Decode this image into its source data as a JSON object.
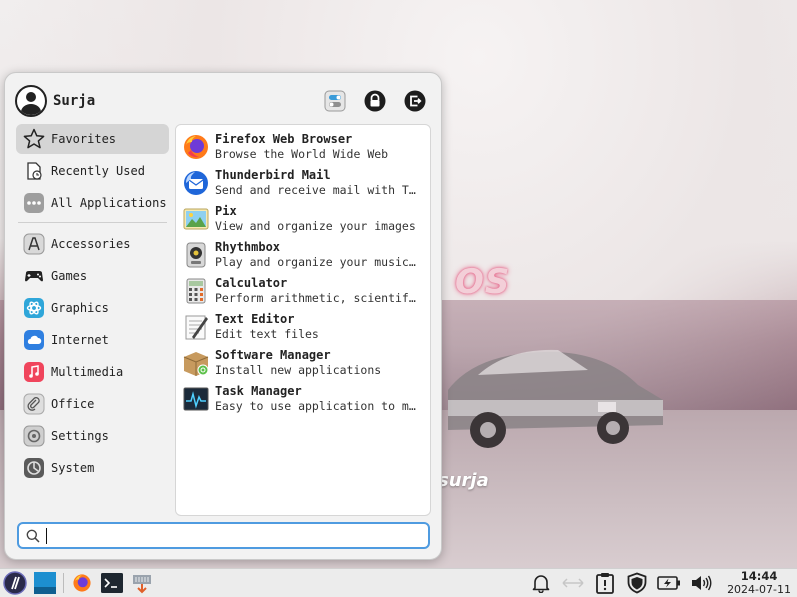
{
  "wallpaper": {
    "title": "OS",
    "subtitle": "surja"
  },
  "menu": {
    "username": "Surja",
    "categories": [
      {
        "label": "Favorites",
        "icon": "star-icon",
        "active": true
      },
      {
        "label": "Recently Used",
        "icon": "recent-document-icon"
      },
      {
        "label": "All Applications",
        "icon": "all-apps-icon"
      },
      {
        "label": "Accessories",
        "icon": "accessories-icon"
      },
      {
        "label": "Games",
        "icon": "gamepad-icon"
      },
      {
        "label": "Graphics",
        "icon": "graphics-icon"
      },
      {
        "label": "Internet",
        "icon": "cloud-icon"
      },
      {
        "label": "Multimedia",
        "icon": "music-note-icon"
      },
      {
        "label": "Office",
        "icon": "paperclip-icon"
      },
      {
        "label": "Settings",
        "icon": "settings-icon"
      },
      {
        "label": "System",
        "icon": "system-icon"
      }
    ],
    "apps": [
      {
        "name": "Firefox Web Browser",
        "description": "Browse the World Wide Web",
        "icon": "firefox-icon"
      },
      {
        "name": "Thunderbird Mail",
        "description": "Send and receive mail with Thunderbird",
        "icon": "thunderbird-icon"
      },
      {
        "name": "Pix",
        "description": "View and organize your images",
        "icon": "pix-icon"
      },
      {
        "name": "Rhythmbox",
        "description": "Play and organize your music collection",
        "icon": "rhythmbox-icon"
      },
      {
        "name": "Calculator",
        "description": "Perform arithmetic, scientific or financial calculations",
        "icon": "calculator-icon"
      },
      {
        "name": "Text Editor",
        "description": "Edit text files",
        "icon": "text-editor-icon"
      },
      {
        "name": "Software Manager",
        "description": "Install new applications",
        "icon": "software-manager-icon"
      },
      {
        "name": "Task Manager",
        "description": "Easy to use application to monitor system resources",
        "icon": "task-manager-icon"
      }
    ],
    "search": {
      "value": "",
      "placeholder": ""
    }
  },
  "taskbar": {
    "clock_time": "14:44",
    "clock_date": "2024-07-11"
  },
  "colors": {
    "accent": "#4f9be0",
    "active_category": "#d5d5d5"
  }
}
